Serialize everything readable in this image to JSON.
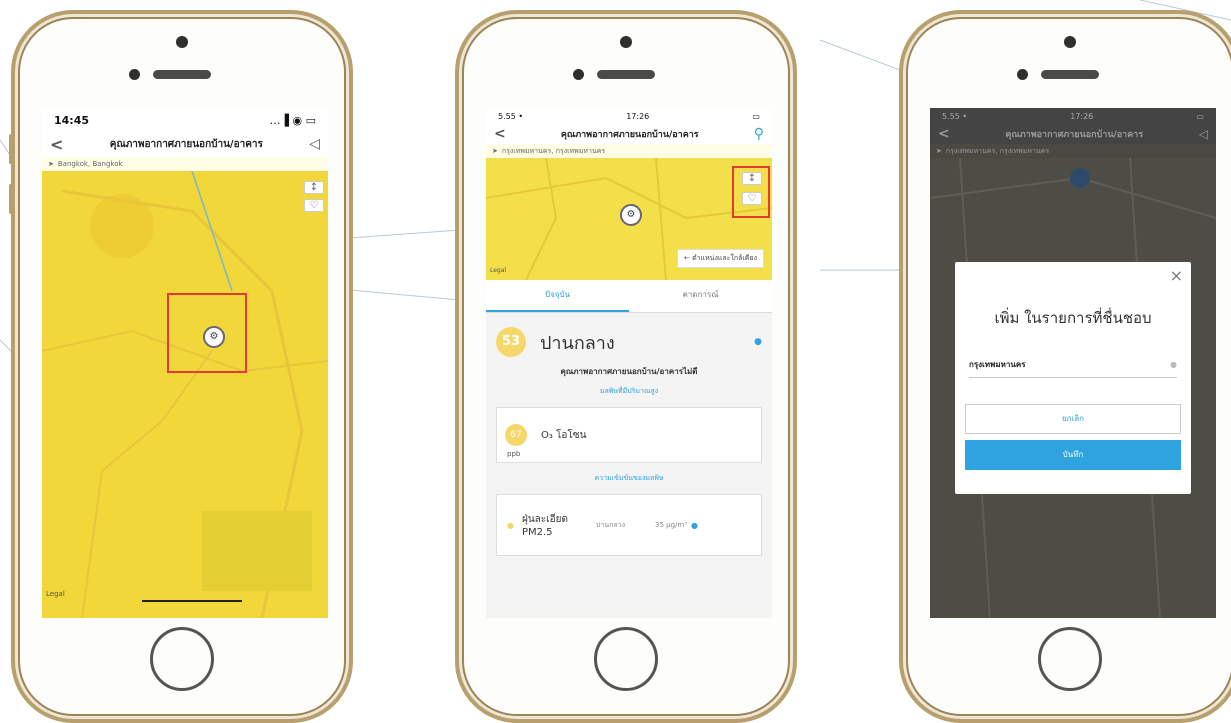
{
  "phone1": {
    "status_time": "14:45",
    "status_icons": "…▐ ◉ ▭",
    "back": "<",
    "title": "คุณภาพอากาศภายนอกบ้าน/อาคาร",
    "send_icon": "◁",
    "location": "Bangkok, Bangkok",
    "map_controls": [
      "↕",
      "♡"
    ],
    "map_labels": [
      "Legal"
    ]
  },
  "phone2": {
    "status_time": "17:26",
    "status_left": "5.55 •",
    "back": "<",
    "title": "คุณภาพอากาศภายนอกบ้าน/อาคาร",
    "location": "กรุงเทพมหานคร, กรุงเทพมหานคร",
    "map_controls": [
      "↕",
      "♡"
    ],
    "map_corner": "Legal",
    "nearby_button": "ตำแหน่งและใกล้เคียง",
    "tabs": [
      "ปัจจุบัน",
      "คาดการณ์"
    ],
    "aqi_value": "53",
    "aqi_level": "ปานกลาง",
    "aqi_desc": "คุณภาพอากาศภายนอกบ้าน/อาคารไม่ดี",
    "pollutant_header": "มลพิษที่มีปริมาณสูง",
    "pollutant_value": "67",
    "pollutant_unit": "ppb",
    "pollutant_name": "O₃ โอโซน",
    "detail_header": "ความเข้มข้นของมลพิษ",
    "pm_name": "ฝุ่นละเอียด PM2.5",
    "pm_level": "ปานกลาง",
    "pm_value": "35 µg/m³"
  },
  "phone3": {
    "status_left": "5.55 •",
    "status_time": "17:26",
    "title": "คุณภาพอากาศภายนอกบ้าน/อาคาร",
    "location": "กรุงเทพมหานคร, กรุงเทพมหานคร",
    "dialog_close": "×",
    "dialog_title": "เพิ่ม ในรายการที่ชื่นชอบ",
    "dialog_input": "กรุงเทพมหานคร",
    "cancel": "ยกเลิก",
    "save": "บันทึก"
  },
  "colors": {
    "map_yellow": "#f2d63c",
    "accent_blue": "#2ea3e0",
    "aqi_circle": "#f6d86a",
    "gold": "#b8a06e",
    "highlight_red": "#e53935"
  }
}
